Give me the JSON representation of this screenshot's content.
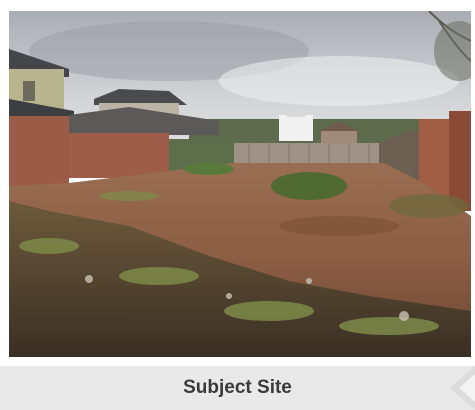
{
  "caption": {
    "text": "Subject Site"
  },
  "colors": {
    "caption_bar": "#e9e9e9",
    "caption_text": "#3a3a3a",
    "sky": "#c9ccd1",
    "ground": "#8a5e44"
  },
  "icons": {
    "corner": "corner-arrow-icon"
  }
}
